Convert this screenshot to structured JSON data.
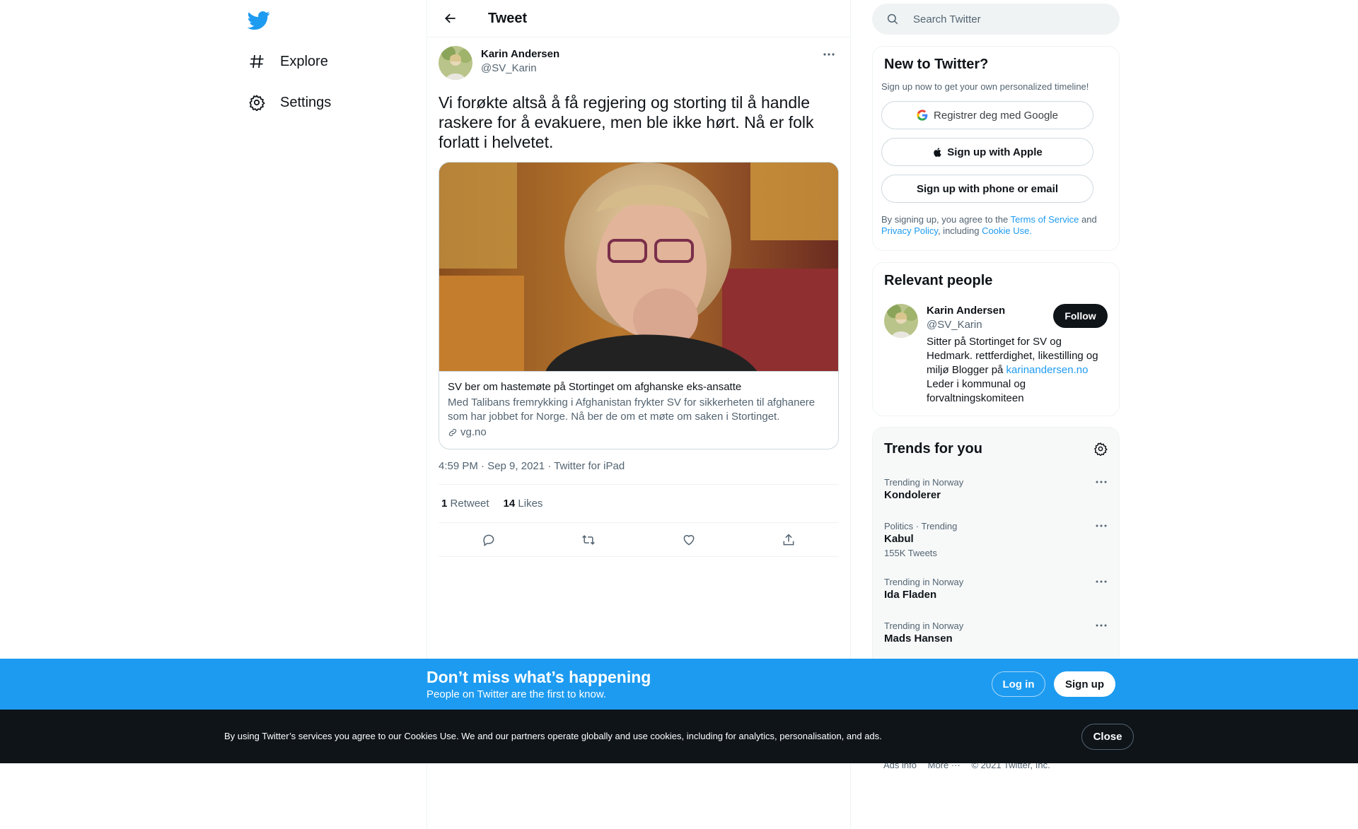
{
  "nav": {
    "logo_icon": "twitter-bird-icon",
    "items": [
      {
        "label": "Explore",
        "icon": "hashtag-icon"
      },
      {
        "label": "Settings",
        "icon": "gear-icon"
      }
    ]
  },
  "header": {
    "title": "Tweet",
    "back_icon": "arrow-left-icon"
  },
  "tweet": {
    "author_name": "Karin Andersen",
    "author_handle": "@SV_Karin",
    "text": "Vi forøkte altså å få regjering og storting til å handle raskere for å evakuere, men ble ikke hørt. Nå er folk forlatt i helvetet.",
    "card": {
      "title": "SV ber om hastemøte på Stortinget om afghanske eks-ansatte",
      "description": "Med Talibans fremrykking i Afghanistan frykter SV for sikkerheten til afghanere som har jobbet for Norge. Nå ber de om et møte om saken i Stortinget.",
      "domain": "vg.no"
    },
    "timestamp": "4:59 PM · Sep 9, 2021 · Twitter for iPad",
    "retweets": "1",
    "retweets_label": "Retweet",
    "likes": "14",
    "likes_label": "Likes"
  },
  "search": {
    "placeholder": "Search Twitter"
  },
  "new_to_twitter": {
    "title": "New to Twitter?",
    "subtitle": "Sign up now to get your own personalized timeline!",
    "google": "Registrer deg med Google",
    "apple": "Sign up with Apple",
    "phone": "Sign up with phone or email",
    "terms_pre": "By signing up, you agree to the ",
    "terms_link": "Terms of Service",
    "terms_and": " and",
    "privacy_link": "Privacy Policy",
    "terms_including": ", including ",
    "cookie_link": "Cookie Use."
  },
  "relevant_people": {
    "title": "Relevant people",
    "name": "Karin Andersen",
    "handle": "@SV_Karin",
    "follow": "Follow",
    "bio_pre": "Sitter på Stortinget for SV og Hedmark. rettferdighet, likestilling og miljø Blogger på ",
    "bio_link": "karinandersen.no",
    "bio_post": "Leder i kommunal og forvaltningskomiteen"
  },
  "trends": {
    "title": "Trends for you",
    "items": [
      {
        "meta": "Trending in Norway",
        "name": "Kondolerer",
        "count": ""
      },
      {
        "meta": "Politics · Trending",
        "name": "Kabul",
        "count": "155K Tweets"
      },
      {
        "meta": "Trending in Norway",
        "name": "Ida Fladen",
        "count": ""
      },
      {
        "meta": "Trending in Norway",
        "name": "Mads Hansen",
        "count": ""
      }
    ]
  },
  "footer": {
    "ads": "Ads info",
    "more": "More ···",
    "copyright": "© 2021 Twitter, Inc."
  },
  "signup_bar": {
    "title": "Don’t miss what’s happening",
    "subtitle": "People on Twitter are the first to know.",
    "login": "Log in",
    "signup": "Sign up"
  },
  "cookie_bar": {
    "text": "By using Twitter’s services you agree to our Cookies Use. We and our partners operate globally and use cookies, including for analytics, personalisation, and ads.",
    "close": "Close"
  },
  "colors": {
    "brand": "#1d9bf0",
    "text": "#0f1419",
    "secondary": "#536471",
    "dark_bar": "#0f1419"
  }
}
